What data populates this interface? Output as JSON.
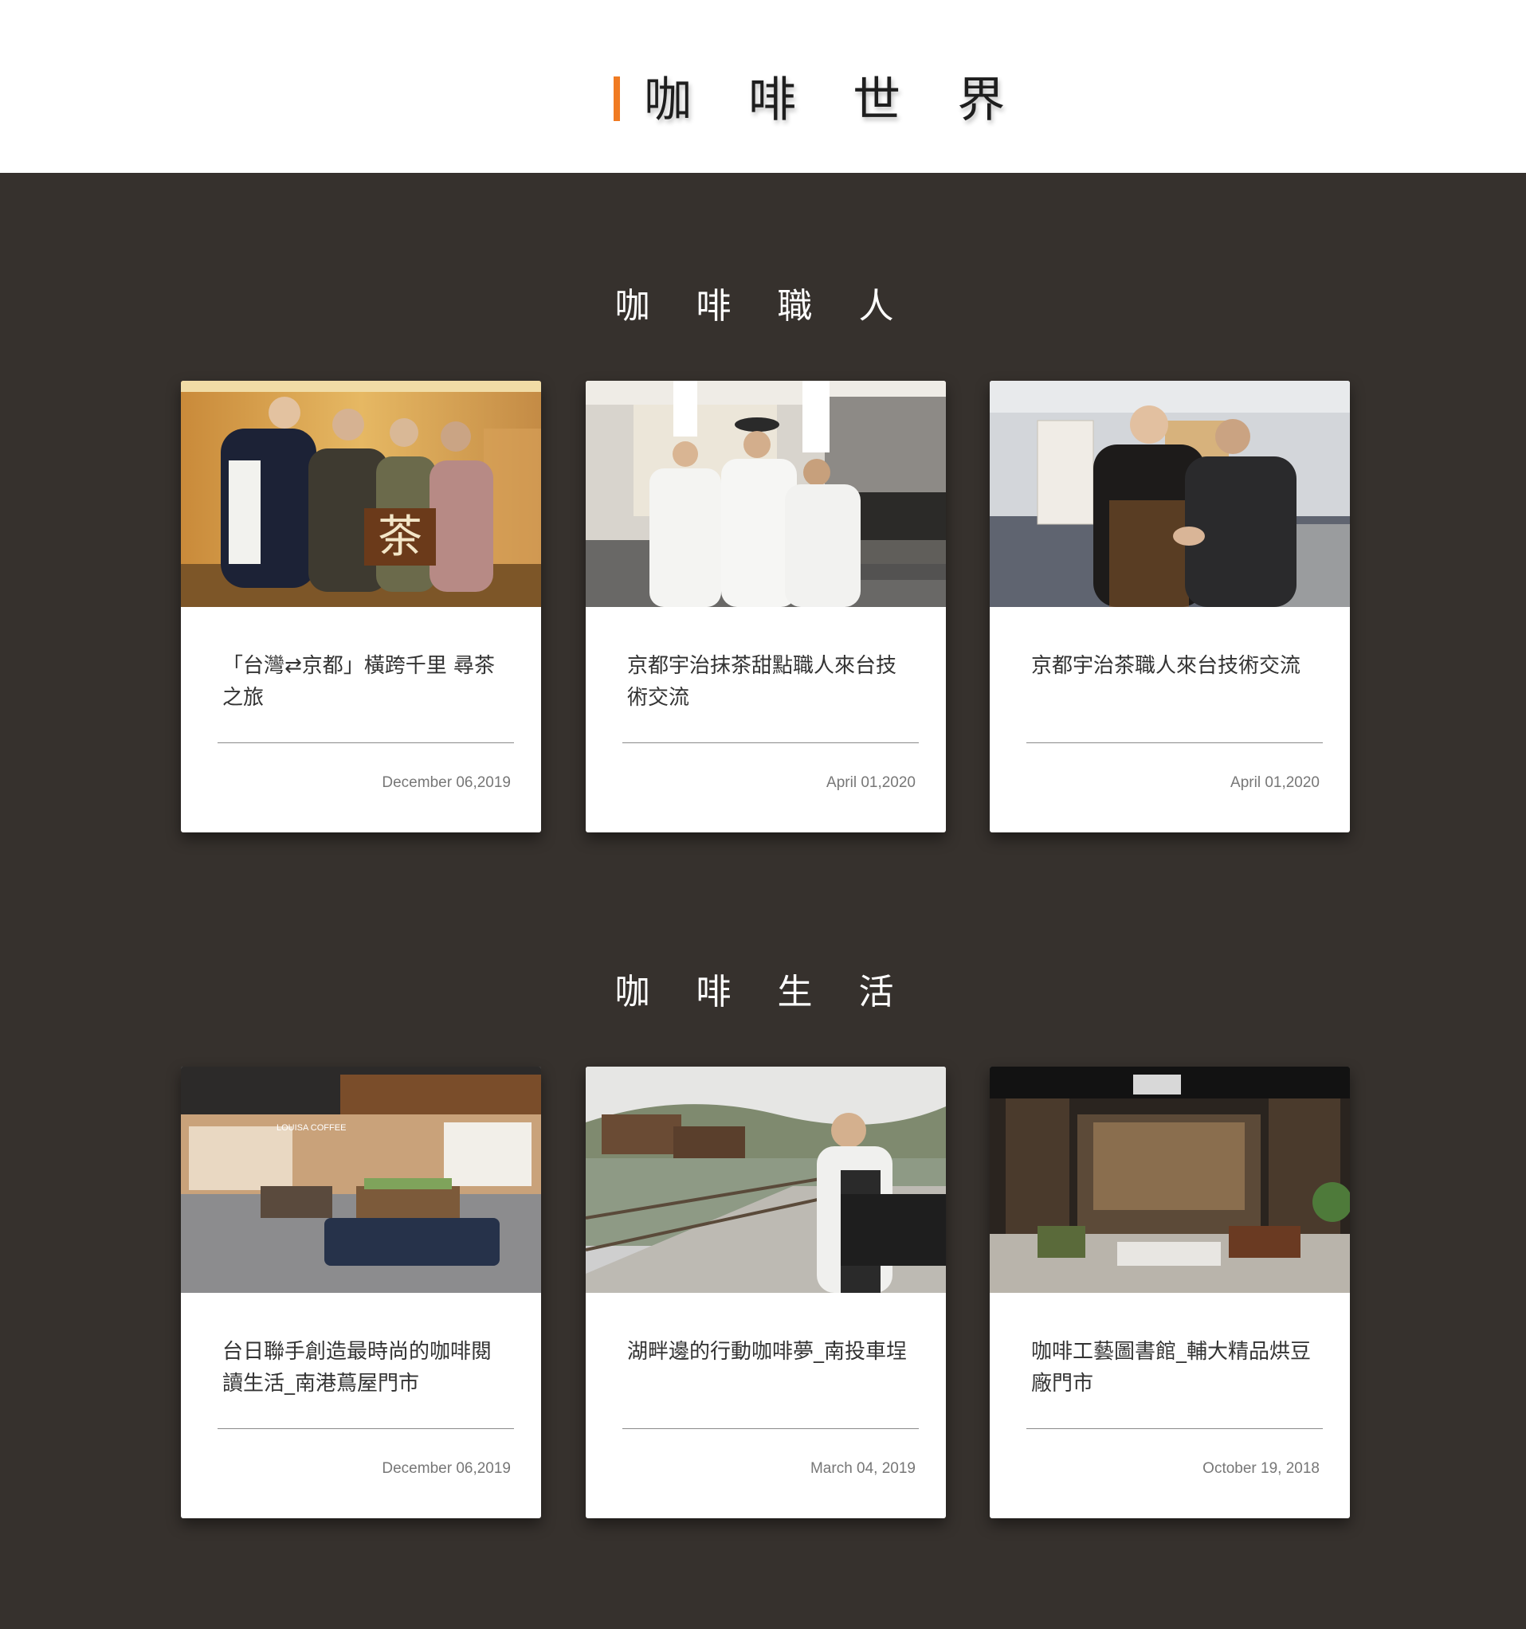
{
  "header": {
    "title": "咖 啡 世 界",
    "accent_color": "#f07b22"
  },
  "theme": {
    "dark_background": "#36312d"
  },
  "sections": [
    {
      "title": "咖 啡 職 人",
      "cards": [
        {
          "title": "「台灣⇄京都」橫跨千里 尋茶之旅",
          "date": "December 06,2019",
          "image": "group-photo-tea-sign"
        },
        {
          "title": "京都宇治抹茶甜點職人來台技術交流",
          "date": "April 01,2020",
          "image": "chefs-at-oven"
        },
        {
          "title": "京都宇治茶職人來台技術交流",
          "date": "April 01,2020",
          "image": "handshake-office"
        }
      ]
    },
    {
      "title": "咖 啡 生 活",
      "cards": [
        {
          "title": "台日聯手創造最時尚的咖啡閱讀生活_南港蔦屋門市",
          "date": "December 06,2019",
          "image": "louisa-coffee-store"
        },
        {
          "title": "湖畔邊的行動咖啡夢_南投車埕",
          "date": "March 04, 2019",
          "image": "lakeside-barista"
        },
        {
          "title": "咖啡工藝圖書館_輔大精品烘豆廠門市",
          "date": "October 19, 2018",
          "image": "library-cafe-interior"
        }
      ]
    }
  ]
}
